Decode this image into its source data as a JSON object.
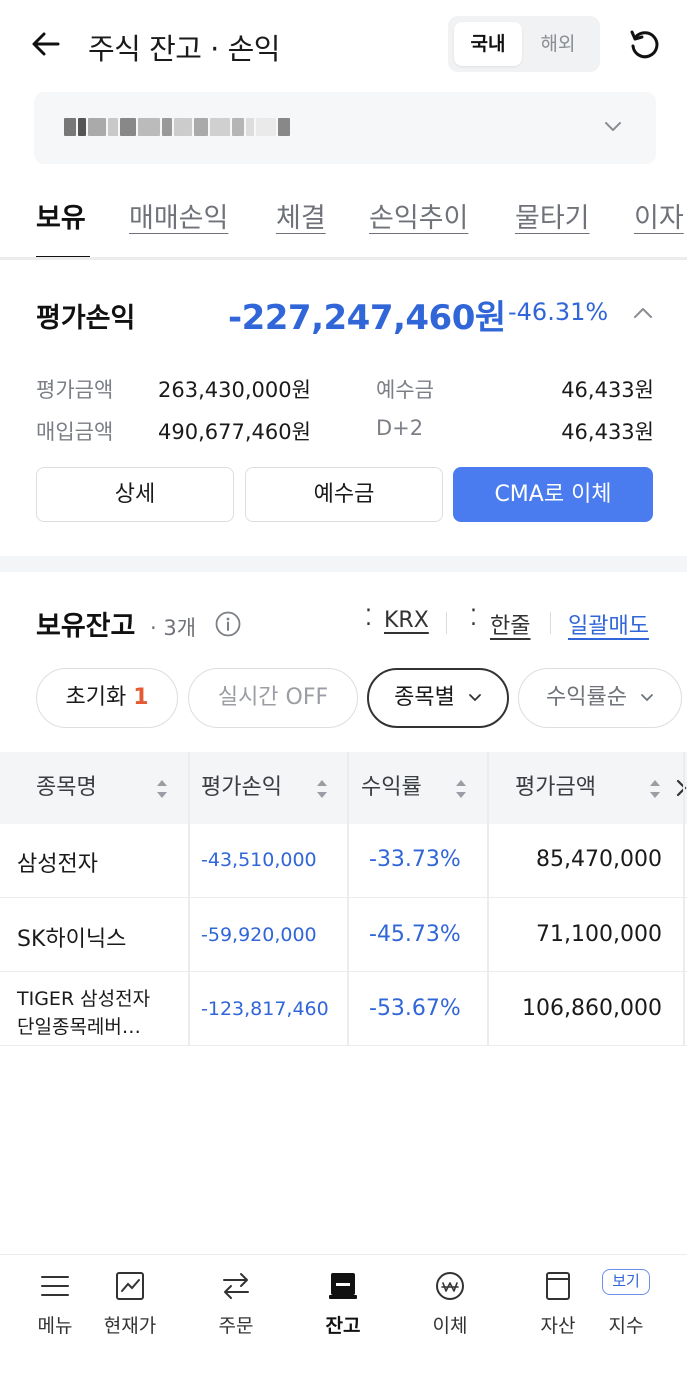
{
  "header": {
    "title": "주식 잔고 · 손익",
    "market_tabs": [
      "국내",
      "해외"
    ],
    "active_market": "국내"
  },
  "account": {
    "masked": true
  },
  "tabs": [
    "보유",
    "매매손익",
    "체결",
    "손익추이",
    "물타기",
    "이자"
  ],
  "active_tab": "보유",
  "summary": {
    "label": "평가손익",
    "amount": "-227,247,460원",
    "rate": "-46.31%",
    "rows": [
      {
        "key": "평가금액",
        "value": "263,430,000원",
        "key2": "예수금",
        "value2": "46,433원"
      },
      {
        "key": "매입금액",
        "value": "490,677,460원",
        "key2": "D+2",
        "value2": "46,433원"
      }
    ],
    "buttons": [
      "상세",
      "예수금",
      "CMA로 이체"
    ]
  },
  "holdings": {
    "title": "보유잔고",
    "count": "· 3개",
    "links": [
      "KRX",
      "한줄",
      "일괄매도"
    ]
  },
  "filters": {
    "reset": "초기화",
    "reset_count": "1",
    "realtime": "실시간 OFF",
    "group": "종목별",
    "sort": "수익률순"
  },
  "table": {
    "headers": [
      "종목명",
      "평가손익",
      "수익률",
      "평가금액"
    ],
    "rows": [
      {
        "name": "삼성전자",
        "name2": "",
        "pl": "-43,510,000",
        "rate": "-33.73%",
        "value": "85,470,000"
      },
      {
        "name": "SK하이닉스",
        "name2": "",
        "pl": "-59,920,000",
        "rate": "-45.73%",
        "value": "71,100,000"
      },
      {
        "name": "TIGER 삼성전자",
        "name2": "단일종목레버…",
        "pl": "-123,817,460",
        "rate": "-53.67%",
        "value": "106,860,000"
      }
    ]
  },
  "bottom_nav": {
    "items": [
      "메뉴",
      "현재가",
      "주문",
      "잔고",
      "이체",
      "자산",
      "지수"
    ],
    "active": "잔고",
    "view_badge": "보기"
  },
  "colors": {
    "loss_blue": "#3166d8",
    "primary_button": "#4a7cf0",
    "accent_red": "#e45a32"
  }
}
